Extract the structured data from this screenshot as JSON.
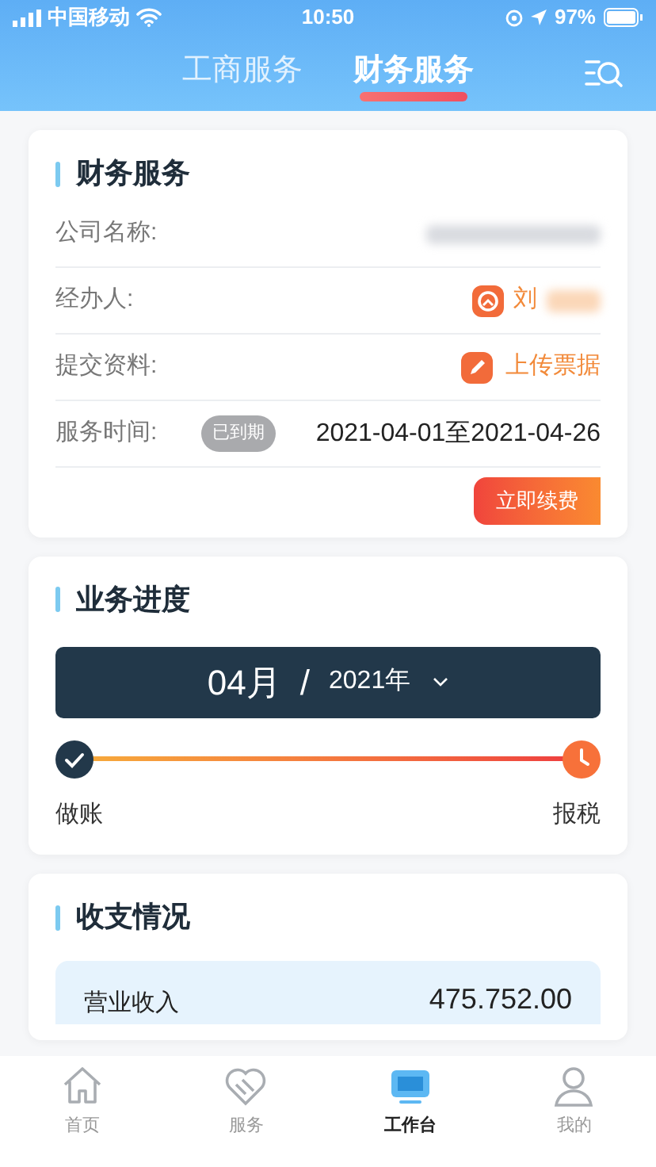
{
  "status_bar": {
    "carrier": "中国移动",
    "time": "10:50",
    "battery": "97%"
  },
  "top_tabs": [
    {
      "label": "工商服务",
      "selected": false
    },
    {
      "label": "财务服务",
      "selected": true
    }
  ],
  "service_card": {
    "title": "财务服务",
    "rows": [
      {
        "kind": "blurred",
        "label": "公司名称:"
      },
      {
        "kind": "person",
        "label": "经办人:",
        "value": "刘"
      },
      {
        "kind": "upload",
        "label": "提交资料:",
        "value": "上传票据"
      },
      {
        "kind": "period",
        "label": "服务时间:",
        "badge": "已到期",
        "value": "2021-04-01至2021-04-26"
      }
    ],
    "button": "立即续费"
  },
  "progress_card": {
    "title": "业务进度",
    "month": "04月",
    "separator": "/",
    "year": "2021年",
    "level": 1,
    "steps": [
      {
        "label": "做账",
        "done": true
      },
      {
        "label": "报税",
        "done": false
      }
    ]
  },
  "finance_card": {
    "title": "收支情况",
    "rows": [
      {
        "label": "营业收入",
        "value": "475.752.00"
      }
    ]
  },
  "bottom_tabs": [
    {
      "kind": "home",
      "label": "首页",
      "selected": false
    },
    {
      "kind": "service",
      "label": "服务",
      "selected": false
    },
    {
      "kind": "desk",
      "label": "工作台",
      "selected": true
    },
    {
      "kind": "me",
      "label": "我的",
      "selected": false
    }
  ]
}
